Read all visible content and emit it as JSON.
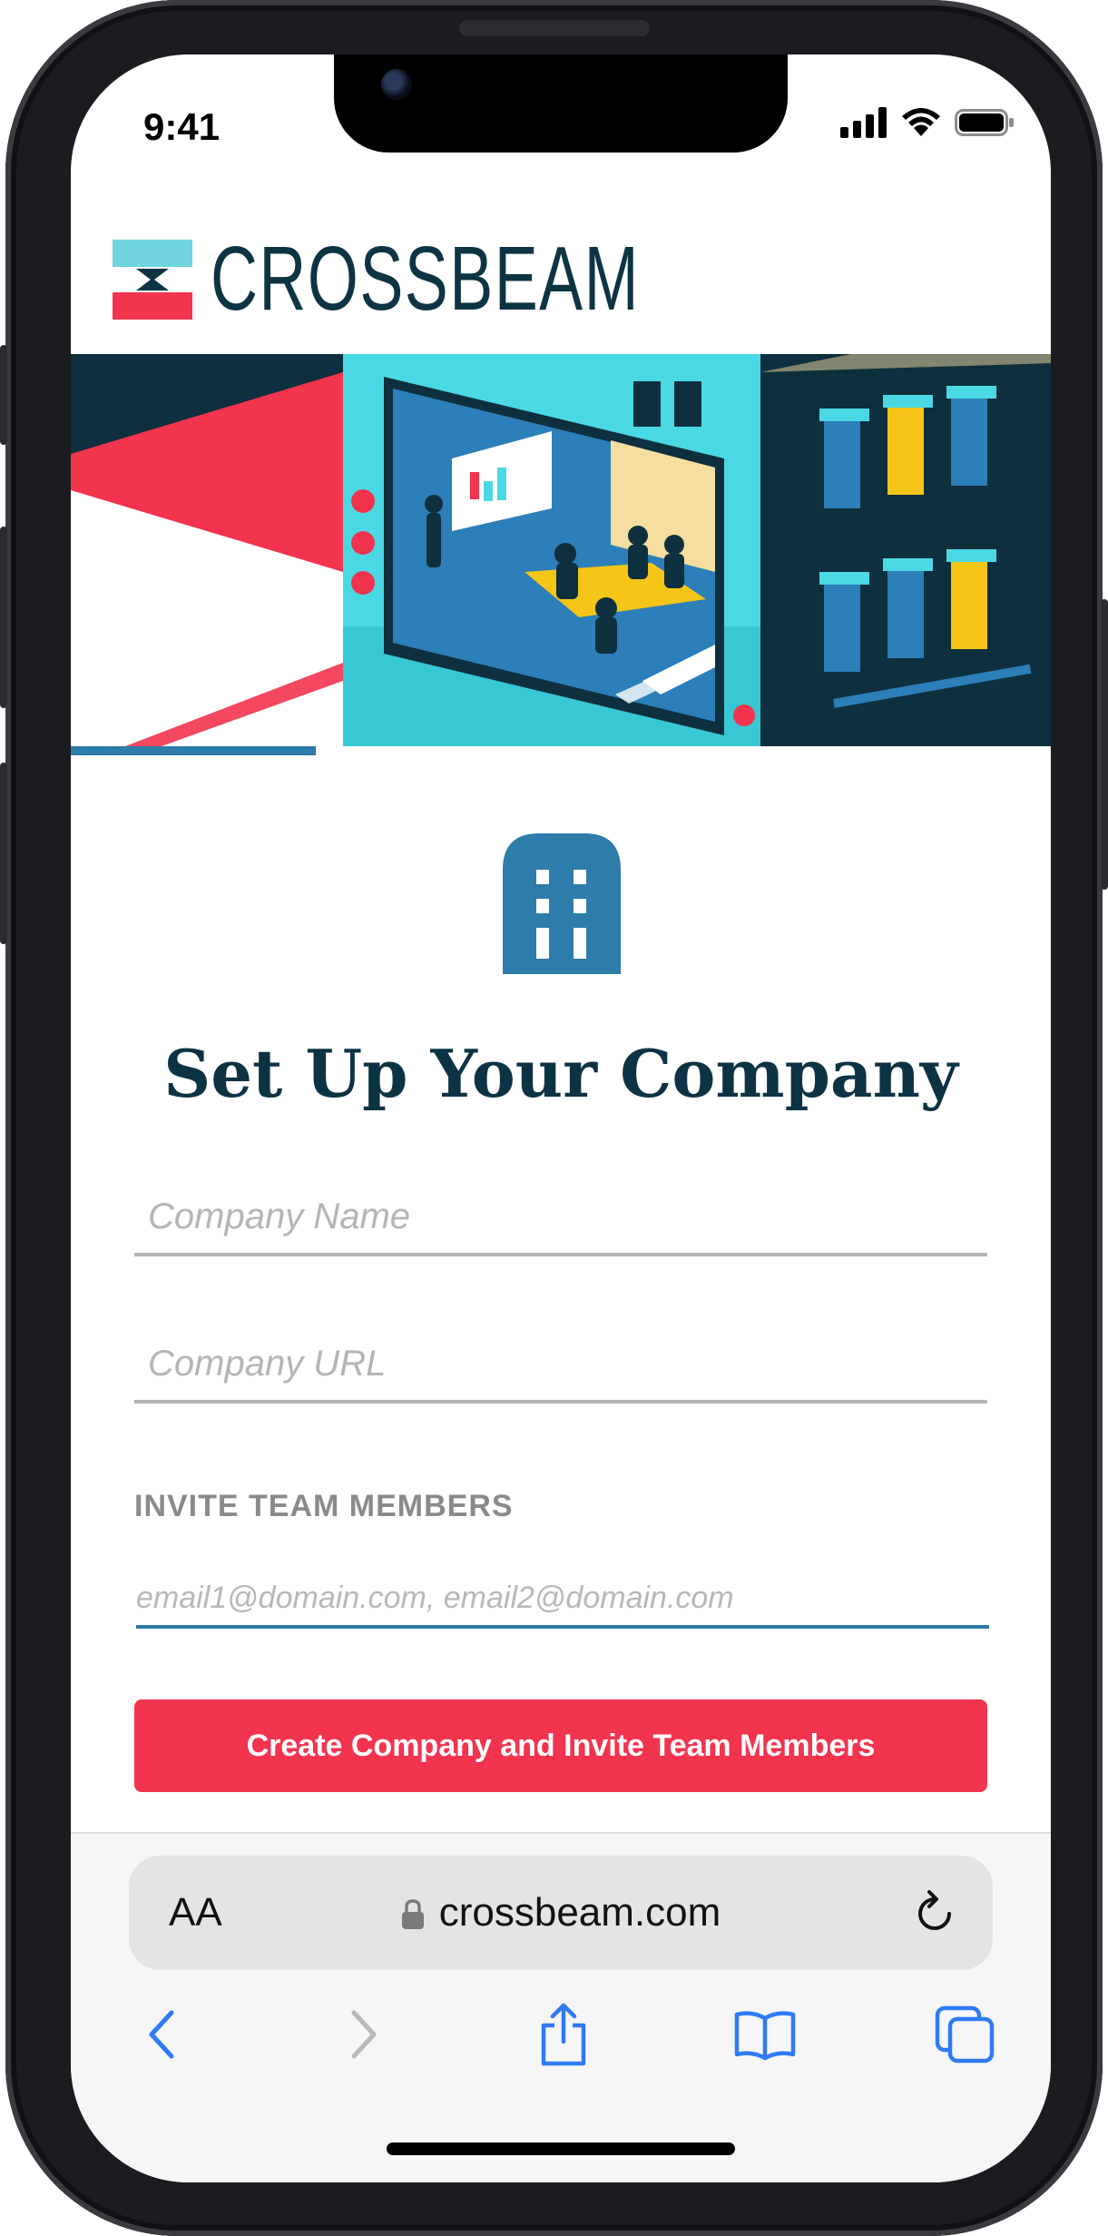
{
  "status_bar": {
    "time": "9:41"
  },
  "brand": {
    "name": "CROSSBEAM",
    "colors": {
      "primary": "#0d3443",
      "red": "#f2344f",
      "teal": "#6fd4de",
      "blue": "#2d7ca9"
    }
  },
  "page": {
    "title": "Set Up Your Company"
  },
  "form": {
    "company_name_placeholder": "Company Name",
    "company_url_placeholder": "Company URL",
    "invite_label": "INVITE TEAM MEMBERS",
    "emails_placeholder": "email1@domain.com, email2@domain.com",
    "submit_label": "Create Company and Invite Team Members"
  },
  "browser": {
    "text_size_label": "AA",
    "url": "crossbeam.com",
    "icons": [
      "lock-icon",
      "reload-icon",
      "back-icon",
      "forward-icon",
      "share-icon",
      "bookmarks-icon",
      "tabs-icon"
    ]
  }
}
